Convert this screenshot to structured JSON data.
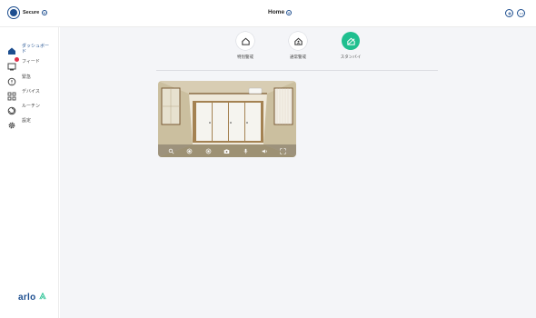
{
  "brand": {
    "label": "Secure"
  },
  "header": {
    "title": "Home"
  },
  "sidebar": {
    "items": [
      {
        "label": "ダッシュボード",
        "icon": "house-icon",
        "active": true
      },
      {
        "label": "フィード",
        "icon": "feed-icon",
        "badge": true
      },
      {
        "label": "緊急",
        "icon": "emergency-icon"
      },
      {
        "label": "デバイス",
        "icon": "devices-icon"
      },
      {
        "label": "ルーチン",
        "icon": "routines-icon"
      },
      {
        "label": "設定",
        "icon": "gear-icon"
      }
    ],
    "logo": "arlo"
  },
  "modes": [
    {
      "label": "特別警戒",
      "icon": "house-shield-icon",
      "active": false
    },
    {
      "label": "通常警戒",
      "icon": "house-person-icon",
      "active": false
    },
    {
      "label": "スタンバイ",
      "icon": "house-off-icon",
      "active": true
    }
  ],
  "camera": {
    "controls": [
      "zoom-icon",
      "record-icon",
      "stop-icon",
      "snapshot-icon",
      "mic-icon",
      "speaker-icon",
      "fullscreen-icon"
    ]
  },
  "colors": {
    "accent": "#1d4e8f",
    "active_mode": "#1fbf8f",
    "badge": "#e0314b",
    "main_bg": "#f4f5f8"
  }
}
